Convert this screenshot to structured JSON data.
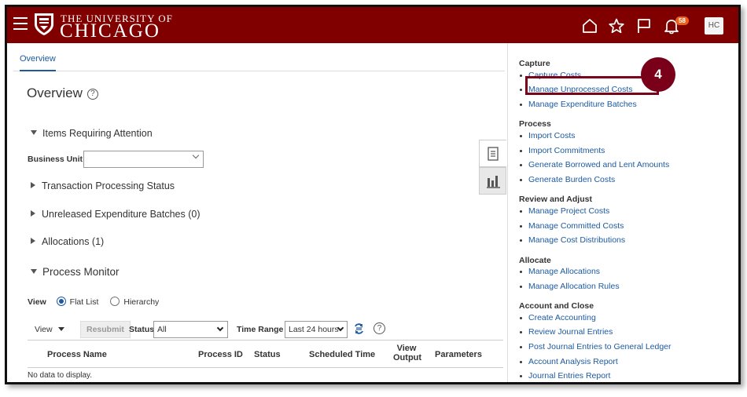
{
  "header": {
    "logo_line1": "THE UNIVERSITY OF",
    "logo_line2": "CHICAGO",
    "notification_count": "58",
    "user_initials": "HC",
    "brand_color": "#800000"
  },
  "tabs": {
    "overview": "Overview"
  },
  "main": {
    "title": "Overview",
    "help": "?",
    "items_requiring_attention": "Items Requiring Attention",
    "business_unit_label": "Business Unit",
    "business_unit_value": "",
    "transaction_processing_status": "Transaction Processing Status",
    "unreleased_batches": "Unreleased Expenditure Batches (0)",
    "allocations": "Allocations (1)",
    "process_monitor": "Process Monitor",
    "view_label": "View",
    "flat_list": "Flat List",
    "hierarchy": "Hierarchy",
    "view_menu": "View",
    "resubmit": "Resubmit",
    "status_label": "Status",
    "status_value": "All",
    "time_range_label": "Time Range",
    "time_range_value": "Last 24 hours",
    "columns": {
      "process_name": "Process Name",
      "process_id": "Process ID",
      "status": "Status",
      "scheduled_time": "Scheduled Time",
      "view_output_1": "View",
      "view_output_2": "Output",
      "parameters": "Parameters"
    },
    "no_data": "No data to display."
  },
  "panel": {
    "groups": [
      {
        "title": "Capture",
        "links": [
          "Capture Costs",
          "Manage Unprocessed Costs",
          "Manage Expenditure Batches"
        ]
      },
      {
        "title": "Process",
        "links": [
          "Import Costs",
          "Import Commitments",
          "Generate Borrowed and Lent Amounts",
          "Generate Burden Costs"
        ]
      },
      {
        "title": "Review and Adjust",
        "links": [
          "Manage Project Costs",
          "Manage Committed Costs",
          "Manage Cost Distributions"
        ]
      },
      {
        "title": "Allocate",
        "links": [
          "Manage Allocations",
          "Manage Allocation Rules"
        ]
      },
      {
        "title": "Account and Close",
        "links": [
          "Create Accounting",
          "Review Journal Entries",
          "Post Journal Entries to General Ledger",
          "Account Analysis Report",
          "Journal Entries Report"
        ]
      }
    ]
  },
  "callout": {
    "number": "4",
    "color": "#7a0019"
  }
}
